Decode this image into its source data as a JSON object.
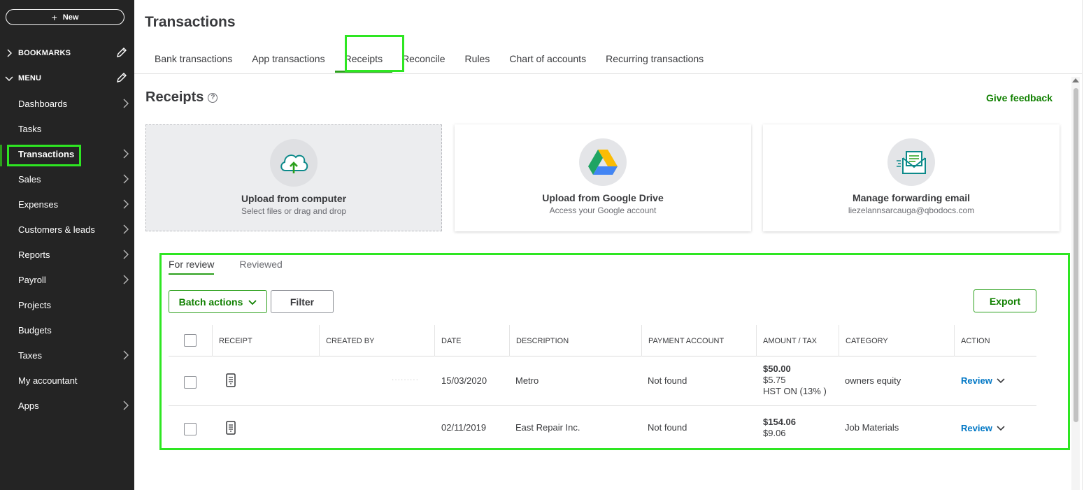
{
  "sidebar": {
    "new_label": "New",
    "bookmarks_label": "BOOKMARKS",
    "menu_label": "MENU",
    "items": [
      {
        "label": "Dashboards",
        "has_arrow": true
      },
      {
        "label": "Tasks",
        "has_arrow": false
      },
      {
        "label": "Transactions",
        "has_arrow": true
      },
      {
        "label": "Sales",
        "has_arrow": true
      },
      {
        "label": "Expenses",
        "has_arrow": true
      },
      {
        "label": "Customers & leads",
        "has_arrow": true
      },
      {
        "label": "Reports",
        "has_arrow": true
      },
      {
        "label": "Payroll",
        "has_arrow": true
      },
      {
        "label": "Projects",
        "has_arrow": false
      },
      {
        "label": "Budgets",
        "has_arrow": false
      },
      {
        "label": "Taxes",
        "has_arrow": true
      },
      {
        "label": "My accountant",
        "has_arrow": false
      },
      {
        "label": "Apps",
        "has_arrow": true
      }
    ]
  },
  "header": {
    "title": "Transactions",
    "tabs": [
      {
        "label": "Bank transactions"
      },
      {
        "label": "App transactions"
      },
      {
        "label": "Receipts"
      },
      {
        "label": "Reconcile"
      },
      {
        "label": "Rules"
      },
      {
        "label": "Chart of accounts"
      },
      {
        "label": "Recurring transactions"
      }
    ]
  },
  "receipts": {
    "title": "Receipts",
    "help_glyph": "?",
    "feedback_label": "Give feedback",
    "cards": [
      {
        "title": "Upload from computer",
        "subtitle": "Select files or drag and drop"
      },
      {
        "title": "Upload from Google Drive",
        "subtitle": "Access your Google account"
      },
      {
        "title": "Manage forwarding email",
        "subtitle": "liezelannsarcauga@qbodocs.com"
      }
    ],
    "sub_tabs": [
      {
        "label": "For review"
      },
      {
        "label": "Reviewed"
      }
    ],
    "batch_actions_label": "Batch actions",
    "filter_label": "Filter",
    "export_label": "Export",
    "columns": [
      "RECEIPT",
      "CREATED BY",
      "DATE",
      "DESCRIPTION",
      "PAYMENT ACCOUNT",
      "AMOUNT / TAX",
      "CATEGORY",
      "ACTION"
    ],
    "rows": [
      {
        "created_by": "·········",
        "date": "15/03/2020",
        "description": "Metro",
        "payment_account": "Not found",
        "amount": "$50.00",
        "tax": "$5.75",
        "tax_name": "HST ON (13% )",
        "category": "owners equity",
        "action": "Review"
      },
      {
        "created_by": "",
        "date": "02/11/2019",
        "description": "East Repair Inc.",
        "payment_account": "Not found",
        "amount": "$154.06",
        "tax": "$9.06",
        "tax_name": "",
        "category": "Job Materials",
        "action": "Review"
      }
    ]
  },
  "colors": {
    "accent_green": "#2ca01c",
    "link_blue": "#0077c5",
    "highlight": "#2ee622",
    "sidebar_bg": "#242424"
  }
}
